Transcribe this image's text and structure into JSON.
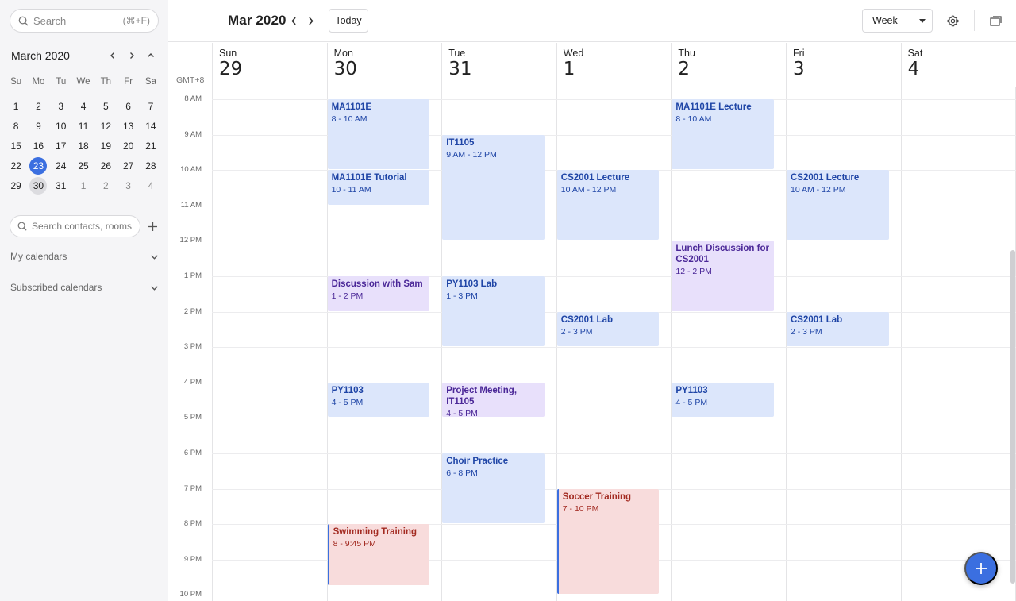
{
  "sidebar": {
    "search": {
      "placeholder": "Search",
      "shortcut": "(⌘+F)"
    },
    "mini_calendar": {
      "title": "March 2020",
      "dow": [
        "Su",
        "Mo",
        "Tu",
        "We",
        "Th",
        "Fr",
        "Sa"
      ],
      "weeks": [
        [
          {
            "d": "1"
          },
          {
            "d": "2"
          },
          {
            "d": "3"
          },
          {
            "d": "4"
          },
          {
            "d": "5"
          },
          {
            "d": "6"
          },
          {
            "d": "7"
          }
        ],
        [
          {
            "d": "8"
          },
          {
            "d": "9"
          },
          {
            "d": "10"
          },
          {
            "d": "11"
          },
          {
            "d": "12"
          },
          {
            "d": "13"
          },
          {
            "d": "14"
          }
        ],
        [
          {
            "d": "15"
          },
          {
            "d": "16"
          },
          {
            "d": "17"
          },
          {
            "d": "18"
          },
          {
            "d": "19"
          },
          {
            "d": "20"
          },
          {
            "d": "21"
          }
        ],
        [
          {
            "d": "22"
          },
          {
            "d": "23",
            "state": "today"
          },
          {
            "d": "24"
          },
          {
            "d": "25"
          },
          {
            "d": "26"
          },
          {
            "d": "27"
          },
          {
            "d": "28"
          }
        ],
        [
          {
            "d": "29"
          },
          {
            "d": "30",
            "state": "selected"
          },
          {
            "d": "31"
          },
          {
            "d": "1",
            "muted": true
          },
          {
            "d": "2",
            "muted": true
          },
          {
            "d": "3",
            "muted": true
          },
          {
            "d": "4",
            "muted": true
          }
        ]
      ]
    },
    "contacts_search": {
      "placeholder": "Search contacts, rooms"
    },
    "sections": {
      "my_calendars": "My calendars",
      "subscribed": "Subscribed calendars"
    }
  },
  "toolbar": {
    "title": "Mar 2020",
    "today_label": "Today",
    "view_label": "Week"
  },
  "timezone": "GMT+8",
  "days": [
    {
      "name": "Sun",
      "num": "29"
    },
    {
      "name": "Mon",
      "num": "30"
    },
    {
      "name": "Tue",
      "num": "31"
    },
    {
      "name": "Wed",
      "num": "1"
    },
    {
      "name": "Thu",
      "num": "2"
    },
    {
      "name": "Fri",
      "num": "3"
    },
    {
      "name": "Sat",
      "num": "4"
    }
  ],
  "hours": [
    "8 AM",
    "9 AM",
    "10 AM",
    "11 AM",
    "12 PM",
    "1 PM",
    "2 PM",
    "3 PM",
    "4 PM",
    "5 PM",
    "6 PM",
    "7 PM",
    "8 PM",
    "9 PM",
    "10 PM"
  ],
  "first_hour": 8,
  "events": [
    {
      "title": "MA1101E",
      "time": "8 - 10 AM",
      "day": 1,
      "start": 8,
      "end": 10,
      "color": "blue"
    },
    {
      "title": "MA1101E Tutorial",
      "time": "10 - 11 AM",
      "day": 1,
      "start": 10,
      "end": 11,
      "color": "blue"
    },
    {
      "title": "Discussion with Sam",
      "time": "1 - 2 PM",
      "day": 1,
      "start": 13,
      "end": 14,
      "color": "purple"
    },
    {
      "title": "PY1103",
      "time": "4 - 5 PM",
      "day": 1,
      "start": 16,
      "end": 17,
      "color": "blue"
    },
    {
      "title": "Swimming Training",
      "time": "8 - 9:45 PM",
      "day": 1,
      "start": 20,
      "end": 21.75,
      "color": "red",
      "bar": true
    },
    {
      "title": "IT1105",
      "time": "9 AM - 12 PM",
      "day": 2,
      "start": 9,
      "end": 12,
      "color": "blue"
    },
    {
      "title": "PY1103 Lab",
      "time": "1 - 3 PM",
      "day": 2,
      "start": 13,
      "end": 15,
      "color": "blue"
    },
    {
      "title": "Project Meeting, IT1105",
      "time": "4 - 5 PM",
      "day": 2,
      "start": 16,
      "end": 17,
      "color": "purple"
    },
    {
      "title": "Choir Practice",
      "time": "6 - 8 PM",
      "day": 2,
      "start": 18,
      "end": 20,
      "color": "blue"
    },
    {
      "title": "CS2001 Lecture",
      "time": "10 AM - 12 PM",
      "day": 3,
      "start": 10,
      "end": 12,
      "color": "blue"
    },
    {
      "title": "CS2001 Lab",
      "time": "2 - 3 PM",
      "day": 3,
      "start": 14,
      "end": 15,
      "color": "blue"
    },
    {
      "title": "Soccer Training",
      "time": "7 - 10 PM",
      "day": 3,
      "start": 19,
      "end": 22,
      "color": "red",
      "bar": true
    },
    {
      "title": "MA1101E Lecture",
      "time": "8 - 10 AM",
      "day": 4,
      "start": 8,
      "end": 10,
      "color": "blue"
    },
    {
      "title": "Lunch Discussion for CS2001",
      "time": "12 - 2 PM",
      "day": 4,
      "start": 12,
      "end": 14,
      "color": "purple"
    },
    {
      "title": "PY1103",
      "time": "4 - 5 PM",
      "day": 4,
      "start": 16,
      "end": 17,
      "color": "blue"
    },
    {
      "title": "CS2001 Lecture",
      "time": "10 AM - 12 PM",
      "day": 5,
      "start": 10,
      "end": 12,
      "color": "blue"
    },
    {
      "title": "CS2001 Lab",
      "time": "2 - 3 PM",
      "day": 5,
      "start": 14,
      "end": 15,
      "color": "blue"
    }
  ],
  "colors": {
    "accent": "#3b6fe0",
    "event_blue": "#dce6fb",
    "event_purple": "#e8e0fb",
    "event_red": "#f8dcdc"
  },
  "icons": {
    "search": "search-icon",
    "prev": "chevron-left-icon",
    "next": "chevron-right-icon",
    "collapse": "chevron-up-icon",
    "expand": "chevron-down-icon",
    "add": "plus-icon",
    "settings": "gear-icon",
    "panel": "panel-toggle-icon",
    "new_event": "plus-icon"
  }
}
